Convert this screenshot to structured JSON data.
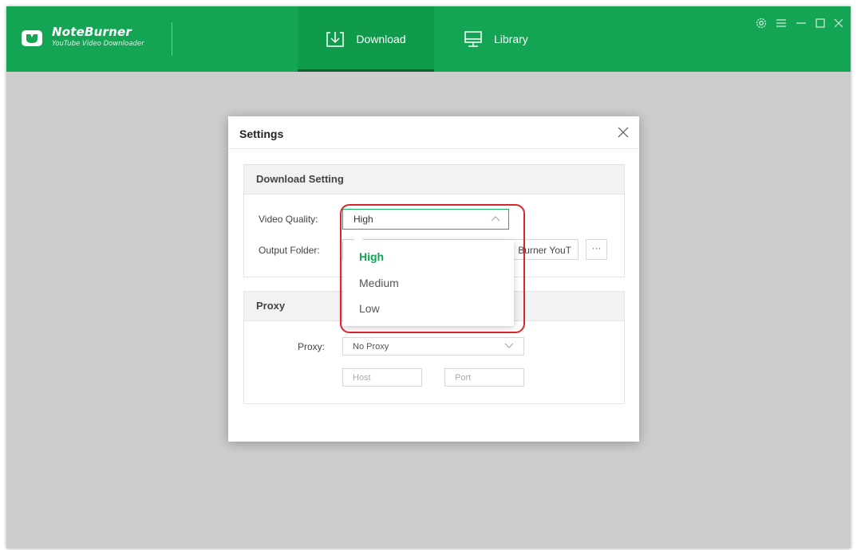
{
  "app": {
    "name": "NoteBurner",
    "subtitle": "YouTube Video Downloader",
    "brand_color": "#13a454"
  },
  "nav": {
    "tabs": [
      {
        "label": "Download",
        "icon": "download-icon",
        "active": true
      },
      {
        "label": "Library",
        "icon": "library-icon",
        "active": false
      }
    ]
  },
  "window_controls": [
    "settings-icon",
    "menu-icon",
    "minimize-icon",
    "maximize-icon",
    "close-icon"
  ],
  "settings_dialog": {
    "title": "Settings",
    "download_setting": {
      "heading": "Download Setting",
      "video_quality_label": "Video Quality:",
      "video_quality_value": "High",
      "output_folder_label": "Output Folder:",
      "output_folder_value": "Burner YouT",
      "browse_label": "···"
    },
    "quality_options": [
      {
        "label": "High",
        "selected": true
      },
      {
        "label": "Medium",
        "selected": false
      },
      {
        "label": "Low",
        "selected": false
      }
    ],
    "proxy": {
      "heading": "Proxy",
      "proxy_label": "Proxy:",
      "proxy_value": "No Proxy",
      "host_placeholder": "Host",
      "port_placeholder": "Port"
    }
  },
  "highlight_color": "#d9242b"
}
